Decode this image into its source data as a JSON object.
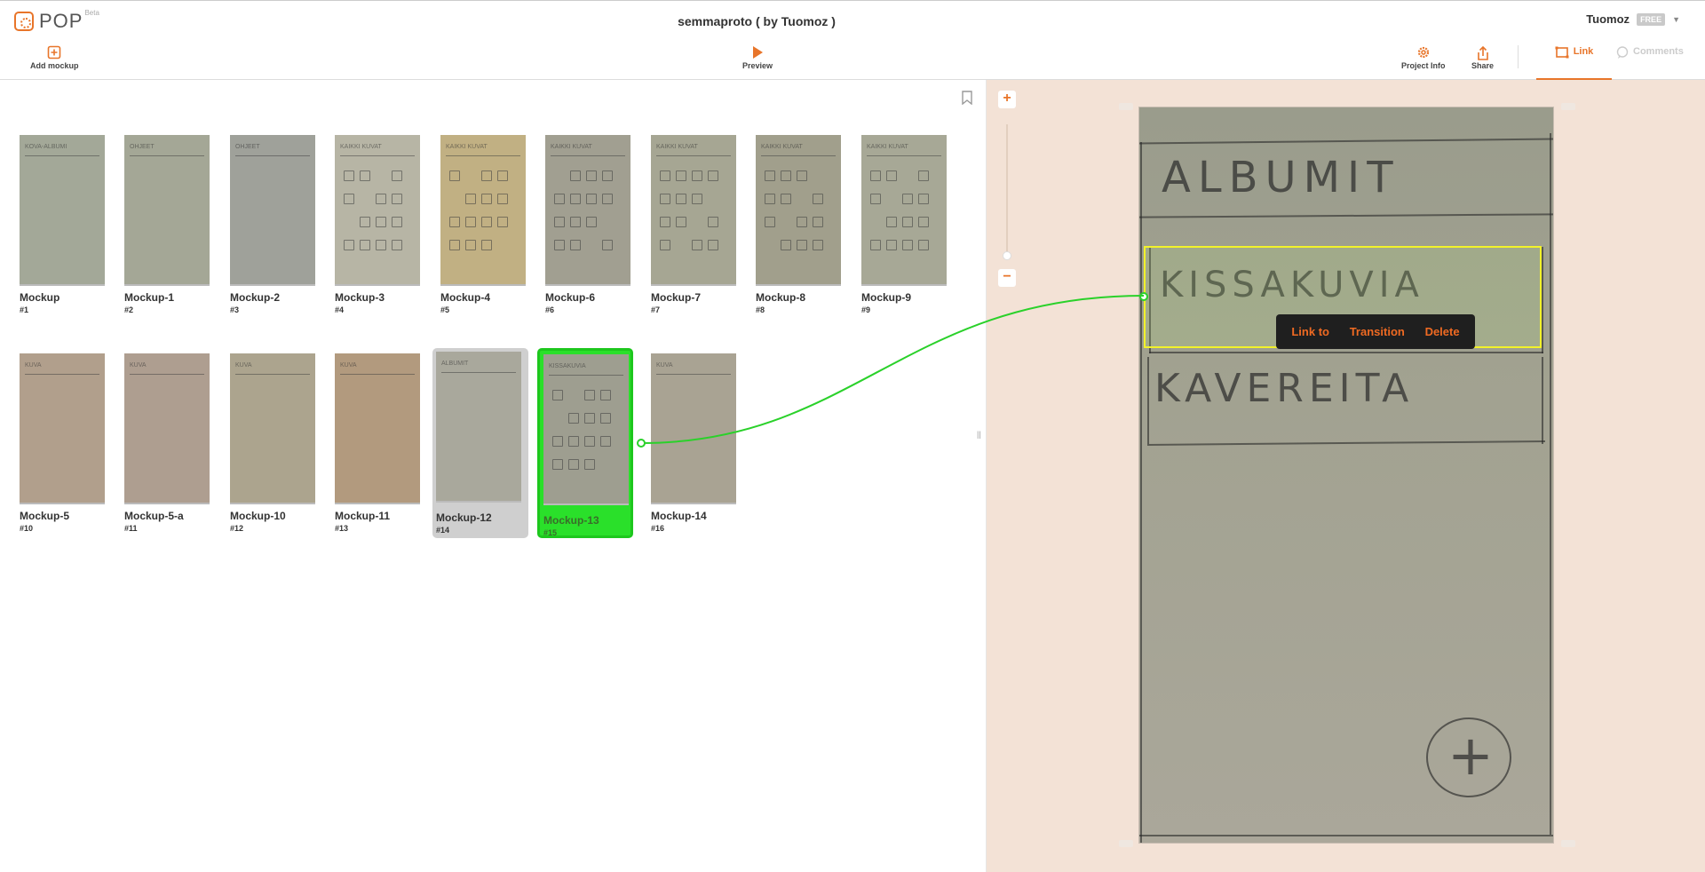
{
  "app": {
    "logo_text": "POP",
    "logo_beta": "Beta",
    "project_title": "semmaproto ( by Tuomoz )",
    "user_name": "Tuomoz",
    "plan_badge": "FREE"
  },
  "toolbar": {
    "add_mockup": "Add mockup",
    "preview": "Preview",
    "project_info": "Project Info",
    "share": "Share",
    "link_tab": "Link",
    "comments_tab": "Comments"
  },
  "mockups": [
    {
      "name": "Mockup",
      "num": "#1",
      "tint": "#a3a898",
      "header": "KOVA-ALBUMI"
    },
    {
      "name": "Mockup-1",
      "num": "#2",
      "tint": "#a4a796",
      "header": "OHJEET"
    },
    {
      "name": "Mockup-2",
      "num": "#3",
      "tint": "#9fa19a",
      "header": "OHJEET"
    },
    {
      "name": "Mockup-3",
      "num": "#4",
      "tint": "#b7b5a5",
      "header": "KAIKKI KUVAT"
    },
    {
      "name": "Mockup-4",
      "num": "#5",
      "tint": "#c1b083",
      "header": "KAIKKI KUVAT"
    },
    {
      "name": "Mockup-6",
      "num": "#6",
      "tint": "#a19f91",
      "header": "KAIKKI KUVAT"
    },
    {
      "name": "Mockup-7",
      "num": "#7",
      "tint": "#a6a693",
      "header": "KAIKKI KUVAT"
    },
    {
      "name": "Mockup-8",
      "num": "#8",
      "tint": "#a19f8c",
      "header": "KAIKKI KUVAT"
    },
    {
      "name": "Mockup-9",
      "num": "#9",
      "tint": "#a7a896",
      "header": "KAIKKI KUVAT"
    },
    {
      "name": "Mockup-5",
      "num": "#10",
      "tint": "#b19f8c",
      "header": "KUVA"
    },
    {
      "name": "Mockup-5-a",
      "num": "#11",
      "tint": "#ae9e90",
      "header": "KUVA"
    },
    {
      "name": "Mockup-10",
      "num": "#12",
      "tint": "#aca48e",
      "header": "KUVA"
    },
    {
      "name": "Mockup-11",
      "num": "#13",
      "tint": "#b29a7e",
      "header": "KUVA"
    },
    {
      "name": "Mockup-12",
      "num": "#14",
      "tint": "#a9a89c",
      "header": "ALBUMIT"
    },
    {
      "name": "Mockup-13",
      "num": "#15",
      "tint": "#9e9e90",
      "header": "KISSAKUVIA"
    },
    {
      "name": "Mockup-14",
      "num": "#16",
      "tint": "#a9a393",
      "header": "KUVA"
    }
  ],
  "canvas": {
    "sketch_title": "ALBUMIT",
    "sketch_row1": "KISSAKUVIA",
    "sketch_row2": "KAVEREITA",
    "plus_symbol": "+"
  },
  "hotspot_menu": {
    "link_to": "Link to",
    "transition": "Transition",
    "delete": "Delete"
  },
  "zoom": {
    "in": "+",
    "out": "−"
  },
  "colors": {
    "accent": "#e8752a",
    "link_line": "#2ad12a",
    "hotspot": "#f2f22a",
    "selected": "#2ae02a",
    "canvas_bg": "#f3e2d6"
  }
}
